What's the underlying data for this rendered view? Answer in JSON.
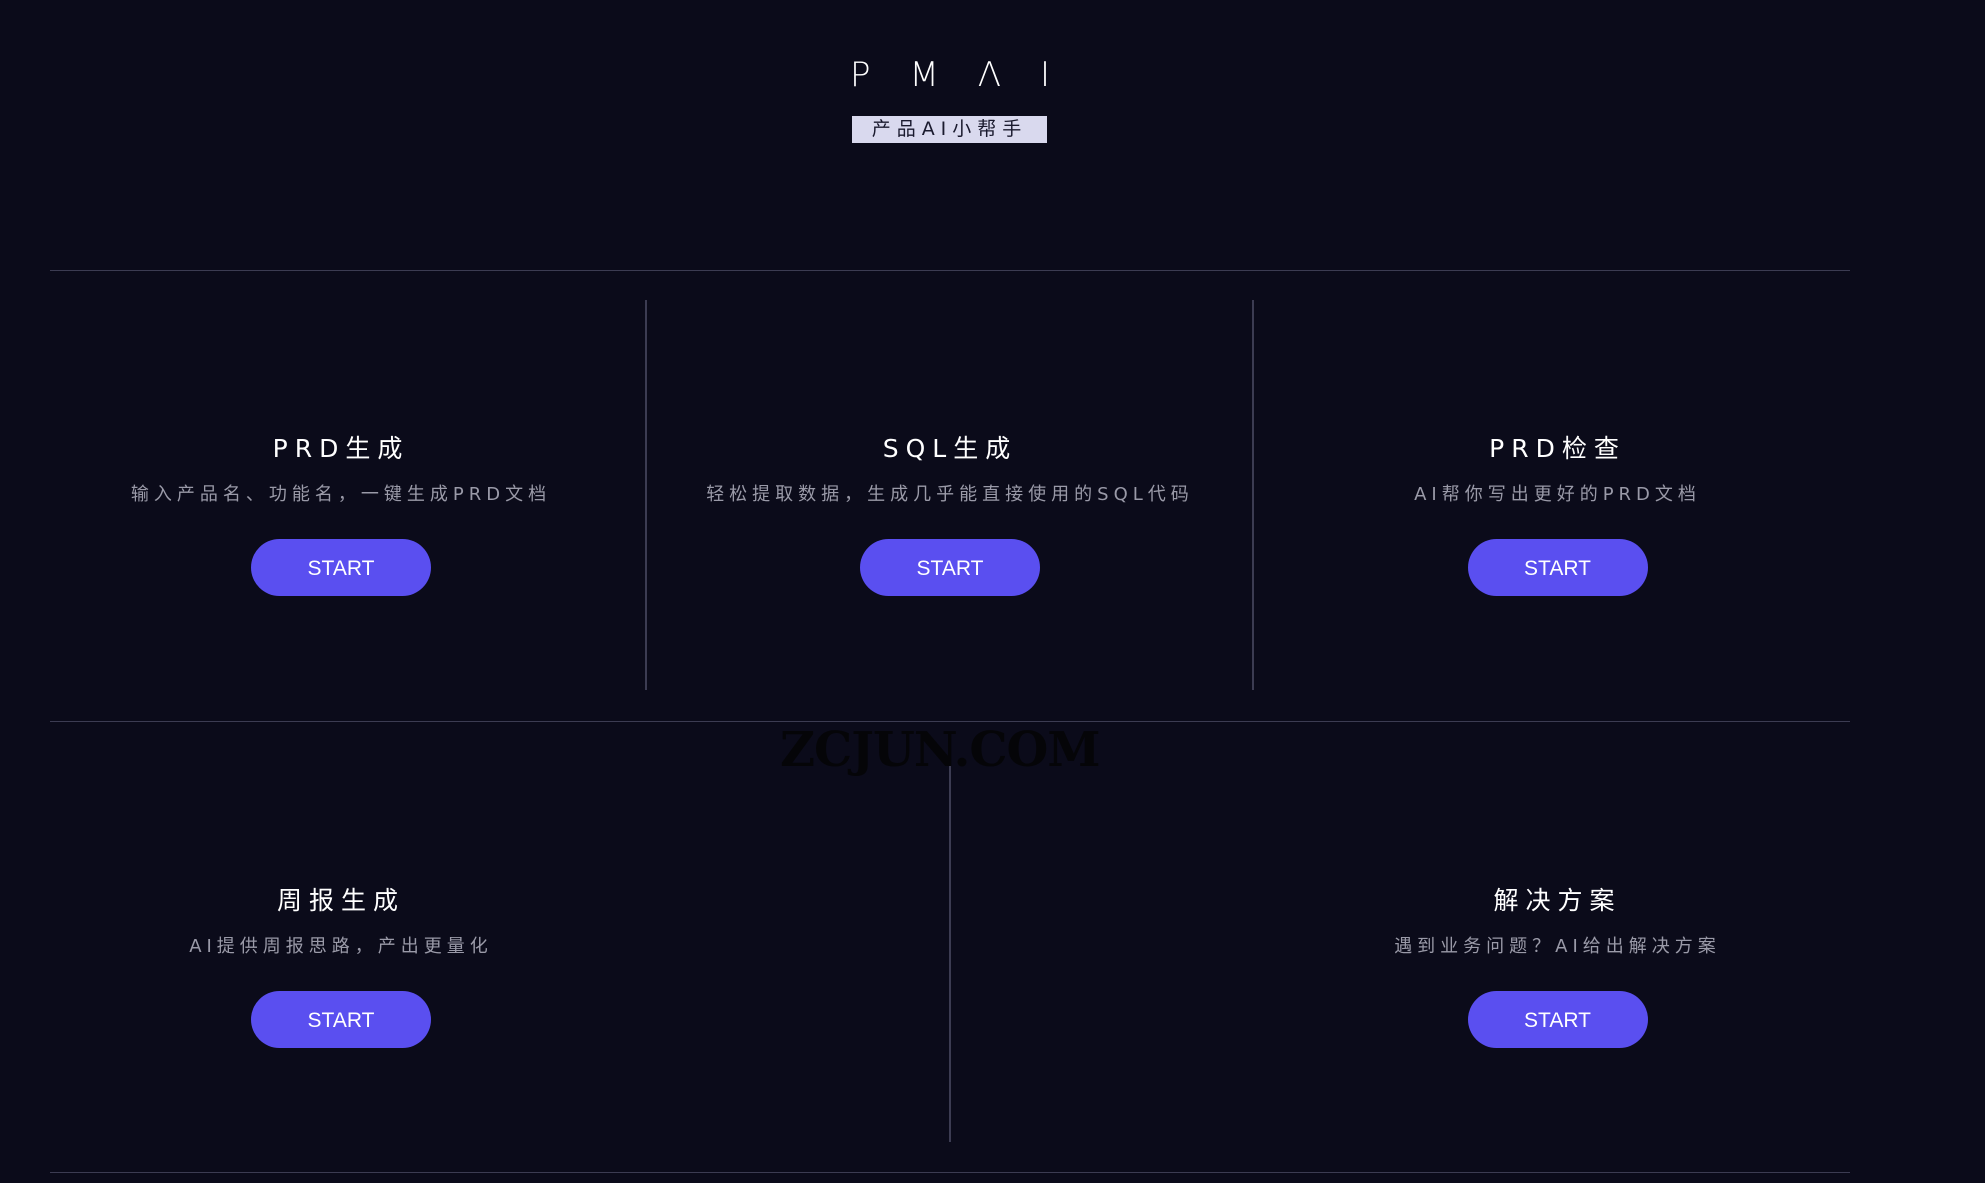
{
  "header": {
    "logo_letters": [
      "P",
      "M",
      "Λ",
      "I"
    ],
    "tagline": "产品AI小帮手"
  },
  "cards": [
    {
      "title": "PRD生成",
      "desc": "输入产品名、功能名，一键生成PRD文档",
      "button": "START"
    },
    {
      "title": "SQL生成",
      "desc": "轻松提取数据，生成几乎能直接使用的SQL代码",
      "button": "START"
    },
    {
      "title": "PRD检查",
      "desc": "AI帮你写出更好的PRD文档",
      "button": "START"
    },
    {
      "title": "周报生成",
      "desc": "AI提供周报思路，产出更量化",
      "button": "START"
    },
    {
      "title": "解决方案",
      "desc": "遇到业务问题？AI给出解决方案",
      "button": "START"
    }
  ],
  "watermark": "ZCJUN.COM",
  "colors": {
    "background": "#0b0b1a",
    "accent": "#5a4ff0",
    "divider": "#3c3c52",
    "tagline_bg": "#d9d9ee"
  }
}
